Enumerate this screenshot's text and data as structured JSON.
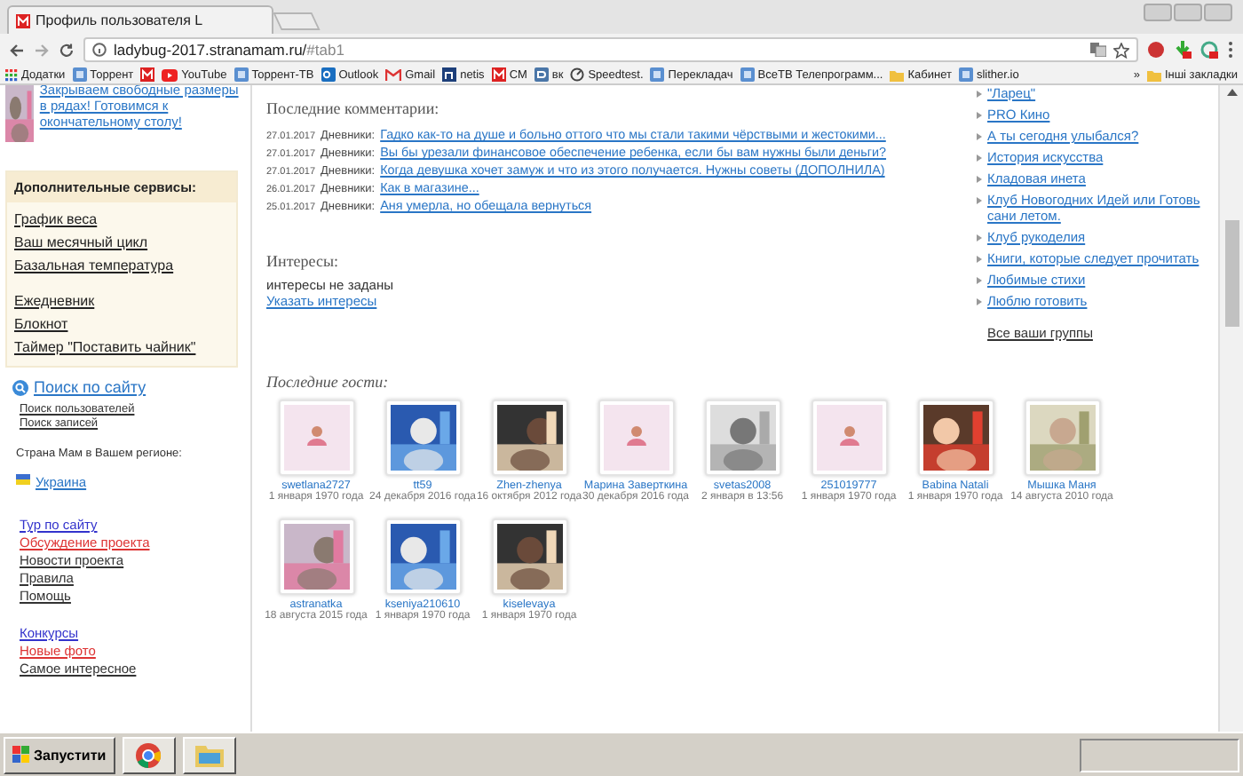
{
  "browser": {
    "tab_title": "Профиль пользователя L",
    "url_host": "ladybug-2017.stranamam.ru/",
    "url_fragment": "#tab1"
  },
  "bookmarks": [
    {
      "label": "Додатки",
      "kind": "apps"
    },
    {
      "label": "Торрент",
      "kind": "generic"
    },
    {
      "kind": "m"
    },
    {
      "label": "YouTube",
      "kind": "youtube"
    },
    {
      "label": "Торрент-ТВ",
      "kind": "generic"
    },
    {
      "label": "Outlook",
      "kind": "outlook"
    },
    {
      "label": "Gmail",
      "kind": "gmail"
    },
    {
      "label": "netis",
      "kind": "netis"
    },
    {
      "label": "CM",
      "kind": "m"
    },
    {
      "label": "вк",
      "kind": "vk"
    },
    {
      "label": "Speedtest.",
      "kind": "gauge"
    },
    {
      "label": "Перекладач",
      "kind": "generic"
    },
    {
      "label": "ВсеТВ Телепрограмм...",
      "kind": "generic"
    },
    {
      "label": "Кабинет",
      "kind": "folder"
    },
    {
      "label": "slither.io",
      "kind": "generic"
    }
  ],
  "bookmarks_more": "»",
  "other_bookmarks": "Інші закладки",
  "sidebar": {
    "promo": "Закрываем свободные размеры в рядах! Готовимся к окончательному столу!",
    "services_title": "Дополнительные сервисы:",
    "services": [
      [
        "График веса",
        "Ваш месячный цикл",
        "Базальная температура"
      ],
      [
        "Ежедневник",
        "Блокнот",
        "Таймер \"Поставить чайник\""
      ]
    ],
    "search_title": "Поиск по сайту",
    "search_links": [
      "Поиск пользователей",
      "Поиск записей"
    ],
    "region_label": "Страна Мам в Вашем регионе:",
    "region": "Украина",
    "links": [
      [
        {
          "label": "Тур по сайту",
          "color": "#3333cc"
        },
        {
          "label": "Обсуждение проекта",
          "color": "#dd3333"
        },
        {
          "label": "Новости проекта",
          "color": "#333333"
        },
        {
          "label": "Правила",
          "color": "#333333"
        },
        {
          "label": "Помощь",
          "color": "#333333"
        }
      ],
      [
        {
          "label": "Конкурсы",
          "color": "#3333cc"
        },
        {
          "label": "Новые фото",
          "color": "#dd3333"
        },
        {
          "label": "Самое интересное",
          "color": "#333333"
        }
      ]
    ]
  },
  "comments": {
    "title": "Последние комментарии:",
    "rows": [
      {
        "date": "27.01.2017",
        "section": "Дневники:",
        "link": "Гадко как-то на душе и больно оттого что мы стали такими чёрствыми и жестокими..."
      },
      {
        "date": "27.01.2017",
        "section": "Дневники:",
        "link": "Вы бы урезали финансовое обеспечение ребенка, если бы вам нужны были деньги?"
      },
      {
        "date": "27.01.2017",
        "section": "Дневники:",
        "link": "Когда девушка хочет замуж и что из этого получается. Нужны советы (ДОПОЛНИЛА)"
      },
      {
        "date": "26.01.2017",
        "section": "Дневники:",
        "link": "Как в магазине..."
      },
      {
        "date": "25.01.2017",
        "section": "Дневники:",
        "link": "Аня умерла, но обещала вернуться"
      }
    ]
  },
  "interests": {
    "title": "Интересы:",
    "value": "интересы не заданы",
    "link": "Указать интересы"
  },
  "guests": {
    "title": "Последние гости:",
    "items": [
      {
        "name": "swetlana2727",
        "date": "1 января 1970 года",
        "kind": "default"
      },
      {
        "name": "tt59",
        "date": "24 декабря 2016 года",
        "kind": "picture"
      },
      {
        "name": "Zhen-zhenya",
        "date": "16 октября 2012 года",
        "kind": "picture"
      },
      {
        "name": "Марина Заверткина",
        "date": "30 декабря 2016 года",
        "kind": "default"
      },
      {
        "name": "svetas2008",
        "date": "2 января в 13:56",
        "kind": "picture"
      },
      {
        "name": "251019777",
        "date": "1 января 1970 года",
        "kind": "default"
      },
      {
        "name": "Babina Natali",
        "date": "1 января 1970 года",
        "kind": "picture"
      },
      {
        "name": "Мышка Маня",
        "date": "14 августа 2010 года",
        "kind": "picture"
      },
      {
        "name": "astranatka",
        "date": "18 августа 2015 года",
        "kind": "picture"
      },
      {
        "name": "kseniya210610",
        "date": "1 января 1970 года",
        "kind": "picture"
      },
      {
        "name": "kiselevaya",
        "date": "1 января 1970 года",
        "kind": "picture"
      }
    ]
  },
  "groups": {
    "items": [
      "\"Ларец\"",
      "PRO Кино",
      "А ты сегодня улыбался?",
      "История искусства",
      "Кладовая инета",
      "Клуб Новогодних Идей или Готовь сани летом.",
      "Клуб рукоделия",
      "Книги, которые следует прочитать",
      "Любимые стихи",
      "Люблю готовить"
    ],
    "all_link": "Все ваши группы"
  },
  "taskbar": {
    "start": "Запустити"
  }
}
